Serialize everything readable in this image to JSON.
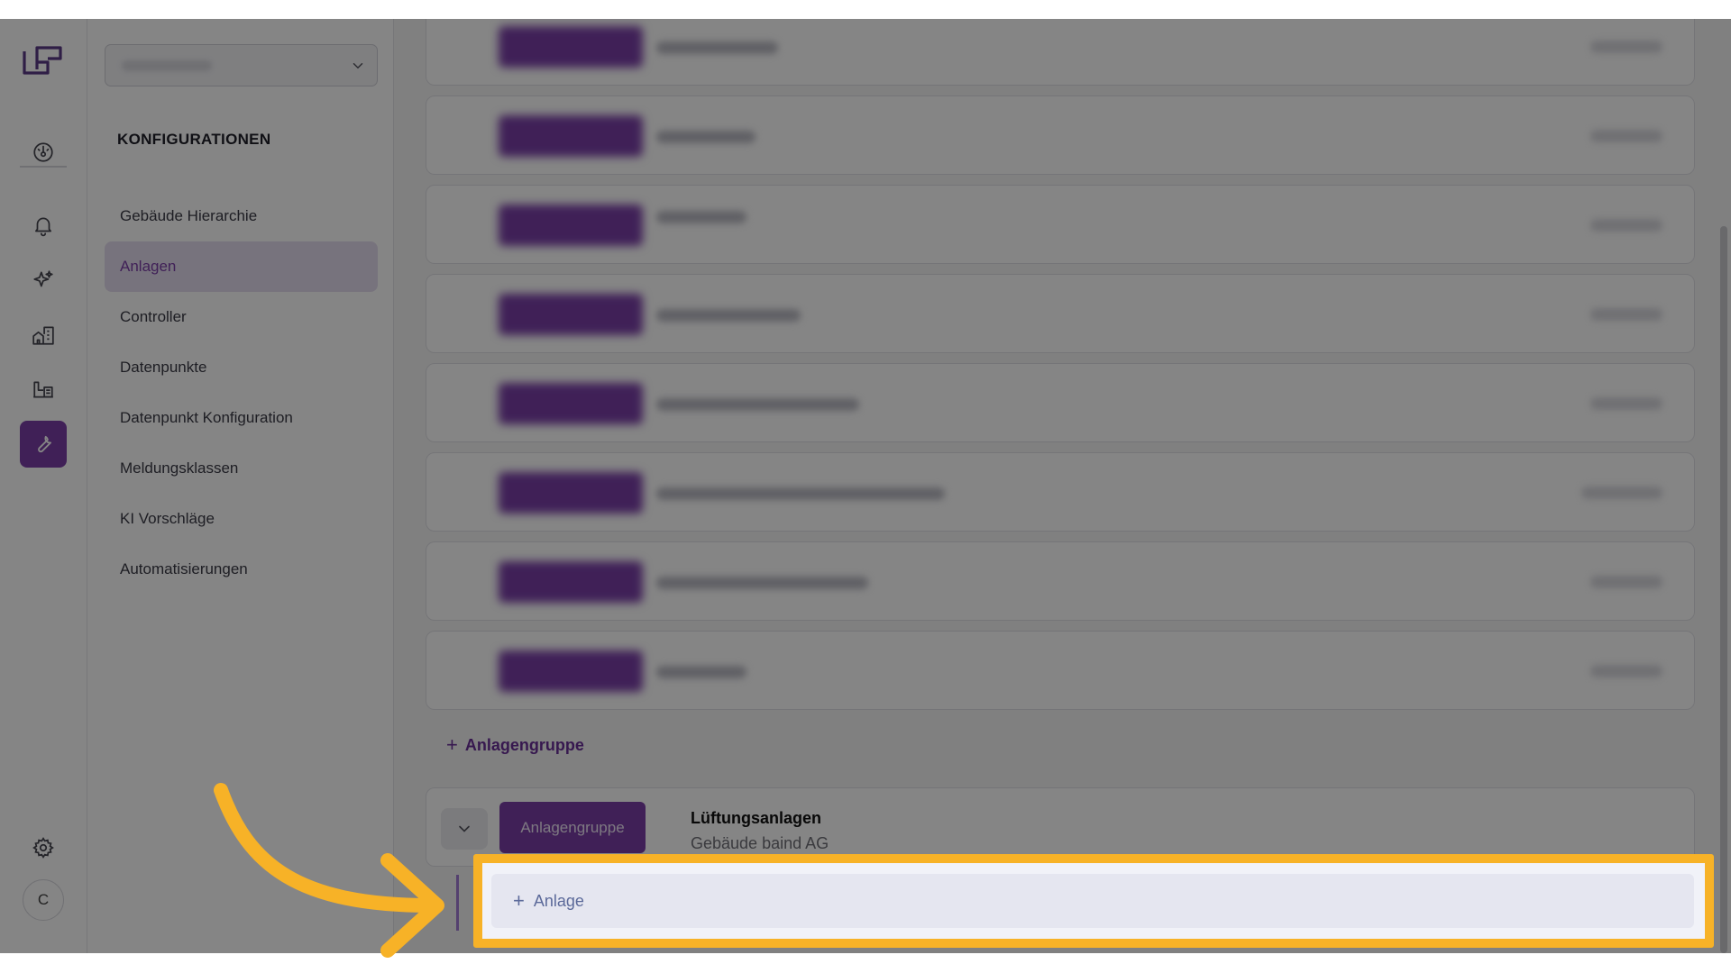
{
  "sidebar": {
    "title": "KONFIGURATIONEN",
    "items": [
      {
        "label": "Gebäude Hierarchie",
        "active": false
      },
      {
        "label": "Anlagen",
        "active": true
      },
      {
        "label": "Controller",
        "active": false
      },
      {
        "label": "Datenpunkte",
        "active": false
      },
      {
        "label": "Datenpunkt Konfiguration",
        "active": false
      },
      {
        "label": "Meldungsklassen",
        "active": false
      },
      {
        "label": "KI Vorschläge",
        "active": false
      },
      {
        "label": "Automatisierungen",
        "active": false
      }
    ]
  },
  "rail": {
    "avatar_initial": "C",
    "icons": [
      "dashboard-gauge-icon",
      "bell-icon",
      "sparkles-icon",
      "buildings-icon",
      "factory-icon",
      "wrench-icon",
      "gear-icon"
    ],
    "active_icon": "wrench-icon"
  },
  "main": {
    "add_group_label": "Anlagengruppe",
    "group": {
      "badge": "Anlagengruppe",
      "title": "Lüftungsanlagen",
      "subtitle": "Gebäude baind AG"
    },
    "add_anlage_label": "Anlage"
  },
  "colors": {
    "accent": "#7b3fa8",
    "highlight": "#f7b227"
  }
}
